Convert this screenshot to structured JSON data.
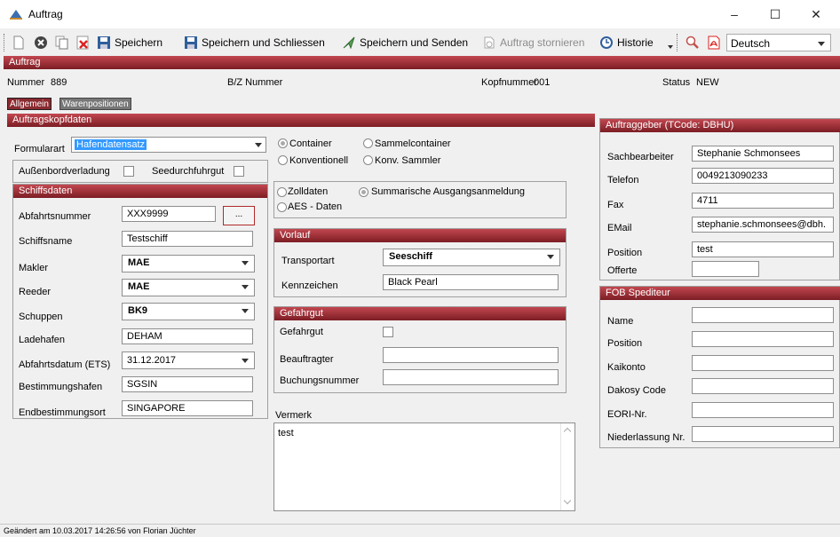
{
  "window": {
    "title": "Auftrag",
    "minimize": "–",
    "maximize": "☐",
    "close": "✕"
  },
  "toolbar": {
    "save": "Speichern",
    "save_close": "Speichern und Schliessen",
    "save_send": "Speichern und Senden",
    "cancel_order": "Auftrag stornieren",
    "history": "Historie",
    "language": "Deutsch"
  },
  "section_auftrag": "Auftrag",
  "header": {
    "nummer_label": "Nummer",
    "nummer_value": "889",
    "bz_label": "B/Z Nummer",
    "kopf_label": "Kopfnummer",
    "kopf_value": "001",
    "status_label": "Status",
    "status_value": "NEW"
  },
  "tabs": [
    "Allgemein",
    "Warenpositionen"
  ],
  "kopf": {
    "title": "Auftragskopfdaten",
    "formularart_label": "Formularart",
    "formularart_value": "Hafendatensatz",
    "aussenbord_label": "Außenbordverladung",
    "seedurch_label": "Seedurchfuhrgut"
  },
  "schiff": {
    "title": "Schiffsdaten",
    "abfahrtsnummer_label": "Abfahrtsnummer",
    "abfahrtsnummer_value": "XXX9999",
    "browse_button": "...",
    "schiffsname_label": "Schiffsname",
    "schiffsname_value": "Testschiff",
    "makler_label": "Makler",
    "makler_value": "MAE",
    "reeder_label": "Reeder",
    "reeder_value": "MAE",
    "schuppen_label": "Schuppen",
    "schuppen_value": "BK9",
    "ladehafen_label": "Ladehafen",
    "ladehafen_value": "DEHAM",
    "abfahrtsdatum_label": "Abfahrtsdatum (ETS)",
    "abfahrtsdatum_value": "31.12.2017",
    "bestimmung_label": "Bestimmungshafen",
    "bestimmung_value": "SGSIN",
    "endbestimmung_label": "Endbestimmungsort",
    "endbestimmung_value": "SINGAPORE"
  },
  "radios1": {
    "container": "Container",
    "sammel": "Sammelcontainer",
    "konv": "Konventionell",
    "konvsammel": "Konv. Sammler"
  },
  "radios2": {
    "zoll": "Zolldaten",
    "summarisch": "Summarische Ausgangsanmeldung",
    "aes": "AES - Daten"
  },
  "vorlauf": {
    "title": "Vorlauf",
    "transportart_label": "Transportart",
    "transportart_value": "Seeschiff",
    "kennzeichen_label": "Kennzeichen",
    "kennzeichen_value": "Black Pearl"
  },
  "gefahrgut": {
    "title": "Gefahrgut",
    "gefahrgut_label": "Gefahrgut",
    "beauftragter_label": "Beauftragter",
    "buchung_label": "Buchungsnummer"
  },
  "vermerk": {
    "label": "Vermerk",
    "value": "test"
  },
  "auftraggeber": {
    "title": "Auftraggeber (TCode: DBHU)",
    "sachbearbeiter_label": "Sachbearbeiter",
    "sachbearbeiter_value": "Stephanie Schmonsees",
    "telefon_label": "Telefon",
    "telefon_value": "0049213090233",
    "fax_label": "Fax",
    "fax_value": "4711",
    "email_label": "EMail",
    "email_value": "stephanie.schmonsees@dbh.",
    "position_label": "Position",
    "position_value": "test",
    "offerte_label": "Offerte"
  },
  "fob": {
    "title": "FOB Spediteur",
    "name_label": "Name",
    "position_label": "Position",
    "kaikonto_label": "Kaikonto",
    "dakosy_label": "Dakosy Code",
    "eori_label": "EORI-Nr.",
    "niederlassung_label": "Niederlassung Nr."
  },
  "status_text": "Geändert am 10.03.2017 14:26:56 von Florian Jüchter"
}
